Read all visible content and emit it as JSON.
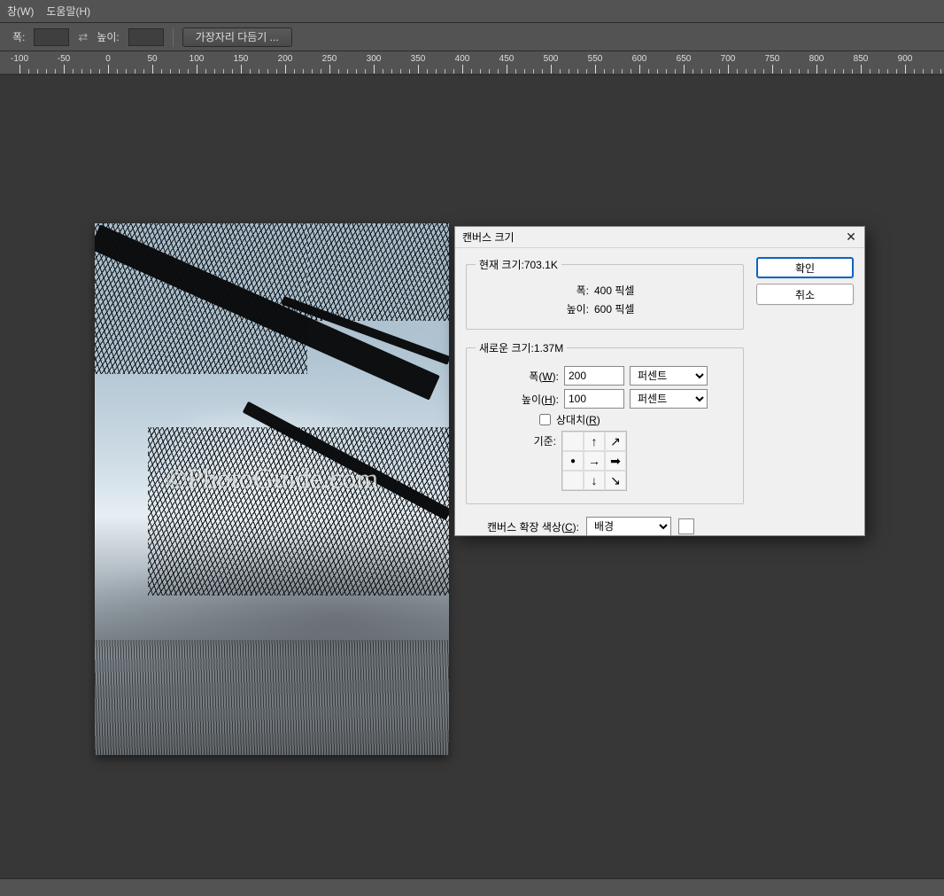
{
  "menu": {
    "window": "창(W)",
    "help": "도움말(H)"
  },
  "options": {
    "width_label": "폭:",
    "height_label": "높이:",
    "width_value": "",
    "height_value": "",
    "edge_button": "가장자리 다듬기 ..."
  },
  "ruler_ticks": [
    -100,
    -50,
    0,
    50,
    100,
    150,
    200,
    250,
    300,
    350,
    400,
    450,
    500,
    550,
    600,
    650,
    700,
    750,
    800,
    850,
    900
  ],
  "watermark": "©PhotoGuide.com",
  "dialog": {
    "title": "캔버스 크기",
    "ok": "확인",
    "cancel": "취소",
    "current": {
      "legend": "현재 크기:703.1K",
      "width_label": "폭:",
      "width_value": "400 픽셀",
      "height_label": "높이:",
      "height_value": "600 픽셀"
    },
    "newsize": {
      "legend": "새로운 크기:1.37M",
      "width_label_html": "폭(<u>W</u>):",
      "width_value": "200",
      "width_unit": "퍼센트",
      "height_label_html": "높이(<u>H</u>):",
      "height_value": "100",
      "height_unit": "퍼센트",
      "relative_label_html": "상대치(<u>R</u>)",
      "anchor_label": "기준:"
    },
    "ext": {
      "label_html": "캔버스 확장 색상(<u>C</u>):",
      "value": "배경"
    }
  }
}
